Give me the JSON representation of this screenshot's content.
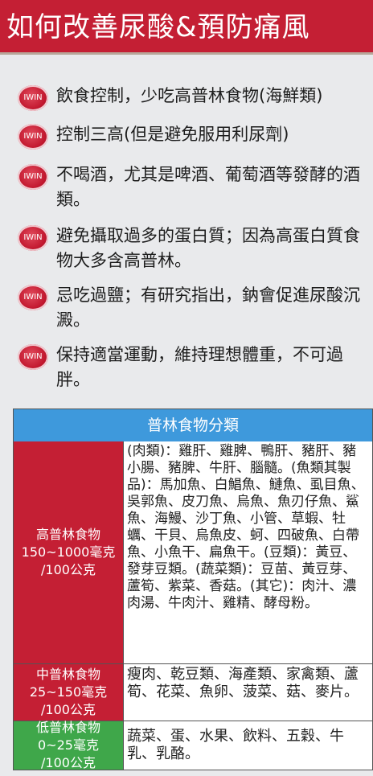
{
  "header": {
    "title": "如何改善尿酸&預防痛風"
  },
  "tips": [
    {
      "badge": "IWIN",
      "text": "飲食控制，少吃高普林食物(海鮮類)"
    },
    {
      "badge": "IWIN",
      "text": "控制三高(但是避免服用利尿劑)"
    },
    {
      "badge": "IWIN",
      "text": "不喝酒，尤其是啤酒、葡萄酒等發酵的酒類。"
    },
    {
      "badge": "IWIN",
      "text": "避免攝取過多的蛋白質；因為高蛋白質食物大多含高普林。"
    },
    {
      "badge": "IWIN",
      "text": "忌吃過鹽；有研究指出，鈉會促進尿酸沉澱。"
    },
    {
      "badge": "IWIN",
      "text": "保持適當運動，維持理想體重，不可過胖。"
    }
  ],
  "table": {
    "title": "普林食物分類",
    "rows": [
      {
        "category_name": "高普林食物",
        "category_range": "150~1000毫克",
        "category_unit": "/100公克",
        "foods": "(肉類)：雞肝、雞脾、鴨肝、豬肝、豬小腸、豬脾、牛肝、腦髓。(魚類其製品)：馬加魚、白鯧魚、鰱魚、虱目魚、吳郭魚、皮刀魚、烏魚、魚刃仔魚、鯊魚、海鰻、沙丁魚、小管、草蝦、牡蠣、干貝、烏魚皮、蚵、四破魚、白帶魚、小魚干、扁魚干。(豆類)：黃豆、發芽豆類。(蔬菜類)：豆苗、黃豆芽、蘆筍、紫菜、香菇。(其它)：肉汁、濃肉湯、牛肉汁、雞精、酵母粉。"
      },
      {
        "category_name": "中普林食物",
        "category_range": "25~150毫克",
        "category_unit": "/100公克",
        "foods": "瘦肉、乾豆類、海產類、家禽類、蘆筍、花菜、魚卵、菠菜、菇、麥片。"
      },
      {
        "category_name": "低普林食物",
        "category_range": "0~25毫克",
        "category_unit": "/100公克",
        "foods": "蔬菜、蛋、水果、飲料、五穀、牛乳、乳酪。"
      }
    ]
  }
}
